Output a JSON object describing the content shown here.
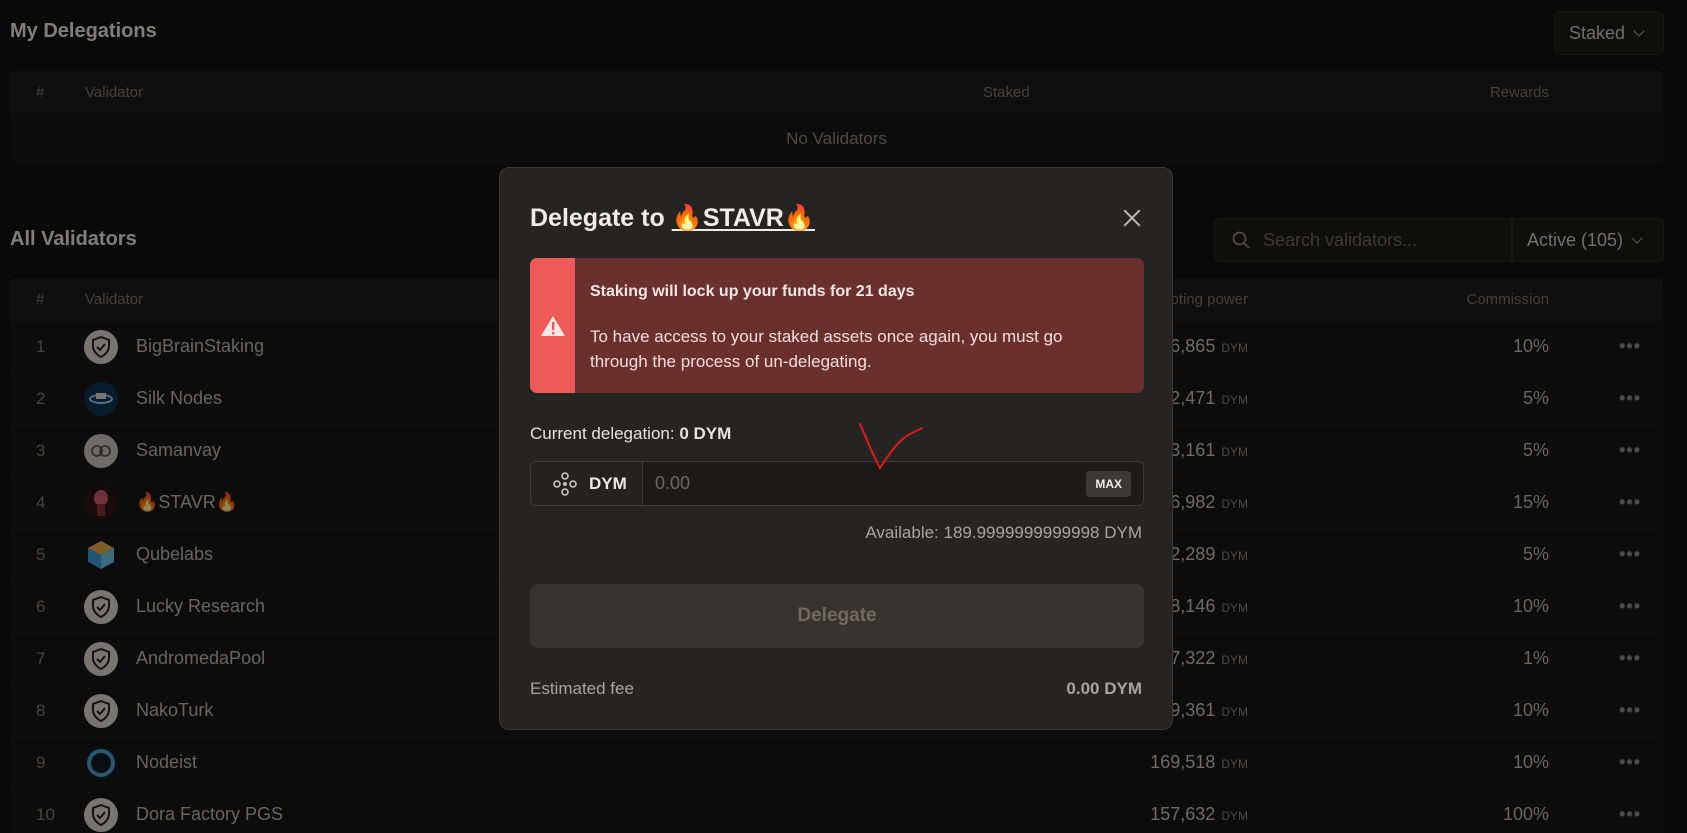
{
  "my_delegations": {
    "title": "My Delegations",
    "filter_value": "Staked",
    "columns": [
      "#",
      "Validator",
      "Staked",
      "Rewards"
    ],
    "empty_text": "No Validators"
  },
  "all_validators": {
    "title": "All Validators",
    "search_placeholder": "Search validators...",
    "filter_value": "Active (105)",
    "columns": [
      "#",
      "Validator",
      "Voting power",
      "Commission"
    ],
    "rows": [
      {
        "idx": "1",
        "name": "BigBrainStaking",
        "vp": "6,865",
        "unit": "DYM",
        "commission": "10%"
      },
      {
        "idx": "2",
        "name": "Silk Nodes",
        "vp": "2,471",
        "unit": "DYM",
        "commission": "5%"
      },
      {
        "idx": "3",
        "name": "Samanvay",
        "vp": "3,161",
        "unit": "DYM",
        "commission": "5%"
      },
      {
        "idx": "4",
        "name": "🔥STAVR🔥",
        "vp": "6,982",
        "unit": "DYM",
        "commission": "15%"
      },
      {
        "idx": "5",
        "name": "Qubelabs",
        "vp": "2,289",
        "unit": "DYM",
        "commission": "5%"
      },
      {
        "idx": "6",
        "name": "Lucky Research",
        "vp": "8,146",
        "unit": "DYM",
        "commission": "10%"
      },
      {
        "idx": "7",
        "name": "AndromedaPool",
        "vp": "7,322",
        "unit": "DYM",
        "commission": "1%"
      },
      {
        "idx": "8",
        "name": "NakoTurk",
        "vp": "9,361",
        "unit": "DYM",
        "commission": "10%"
      },
      {
        "idx": "9",
        "name": "Nodeist",
        "vp": "169,518",
        "unit": "DYM",
        "commission": "10%"
      },
      {
        "idx": "10",
        "name": "Dora Factory PGS",
        "vp": "157,632",
        "unit": "DYM",
        "commission": "100%"
      }
    ]
  },
  "modal": {
    "title_prefix": "Delegate to ",
    "validator_name": "🔥STAVR🔥",
    "warning_title": "Staking will lock up your funds for 21 days",
    "warning_body": "To have access to your staked assets once again, you must go through the process of un-delegating.",
    "current_delegation_label": "Current delegation:",
    "current_delegation_value": "0 DYM",
    "token": "DYM",
    "amount_placeholder": "0.00",
    "max_label": "MAX",
    "available": "Available: 189.9999999999998 DYM",
    "delegate_label": "Delegate",
    "fee_label": "Estimated fee",
    "fee_value": "0.00 DYM"
  },
  "colors": {
    "accent_warning": "#ee5a58",
    "warning_bg": "#6a302e",
    "annotation": "#e0191b"
  }
}
